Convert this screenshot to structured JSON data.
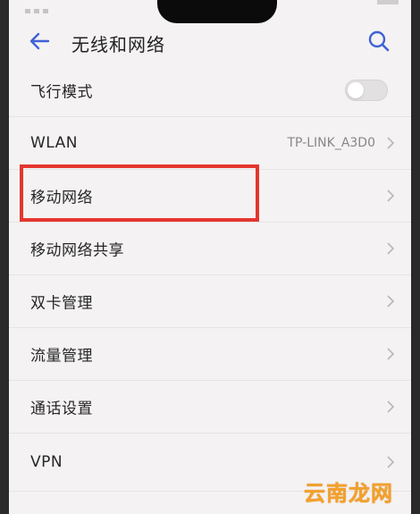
{
  "header": {
    "title": "无线和网络",
    "back_icon": "back-arrow-icon",
    "search_icon": "search-icon"
  },
  "settings": {
    "airplane_mode": {
      "label": "飞行模式",
      "enabled": false
    },
    "wlan": {
      "label": "WLAN",
      "value": "TP-LINK_A3D0"
    },
    "mobile_network": {
      "label": "移动网络"
    },
    "mobile_hotspot": {
      "label": "移动网络共享"
    },
    "dual_sim": {
      "label": "双卡管理"
    },
    "data_usage": {
      "label": "流量管理"
    },
    "call_settings": {
      "label": "通话设置"
    },
    "vpn": {
      "label": "VPN"
    }
  },
  "annotation": {
    "highlight_color": "#e5352f"
  },
  "watermark": {
    "text": "云南龙网",
    "color": "#f2a12a"
  },
  "colors": {
    "accent": "#3f62d8",
    "background": "#f4f2f2"
  }
}
